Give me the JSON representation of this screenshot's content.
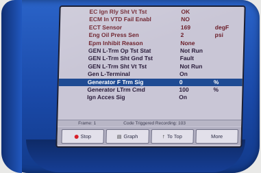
{
  "rows": [
    {
      "label": "EC Ign Rly Sht Vt Tst",
      "value": "OK",
      "unit": ""
    },
    {
      "label": "ECM In VTD Fail Enabl",
      "value": "NO",
      "unit": ""
    },
    {
      "label": "ECT Sensor",
      "value": "169",
      "unit": "degF"
    },
    {
      "label": "Eng Oil Press Sen",
      "value": "2",
      "unit": "psi"
    },
    {
      "label": "Epm Inhibit Reason",
      "value": "None",
      "unit": ""
    },
    {
      "label": "GEN L-Trm Op Tst Stat",
      "value": "Not Run",
      "unit": ""
    },
    {
      "label": "GEN L-Trm Sht Gnd Tst",
      "value": "Fault",
      "unit": ""
    },
    {
      "label": "GEN L-Trm Sht Vt Tst",
      "value": "Not Run",
      "unit": ""
    },
    {
      "label": "Gen L-Terminal",
      "value": "On",
      "unit": ""
    },
    {
      "label": "Generator F Trm Sig",
      "value": "0",
      "unit": "%"
    },
    {
      "label": "Generator LTrm Cmd",
      "value": "100",
      "unit": "%"
    },
    {
      "label": "Ign Acces Sig",
      "value": "On",
      "unit": ""
    }
  ],
  "selected_index": 9,
  "status": {
    "frame": "Frame: 1",
    "recording": "Code Triggered Recording: 103"
  },
  "softkeys": {
    "stop": "Stop",
    "graph": "Graph",
    "to_top": "To Top",
    "more": "More"
  },
  "colors": {
    "screen_bg": "#c9c6d6",
    "text": "#6c1f2a",
    "selected_bg": "#1f4b93",
    "device_blue": "#1a49a8"
  }
}
